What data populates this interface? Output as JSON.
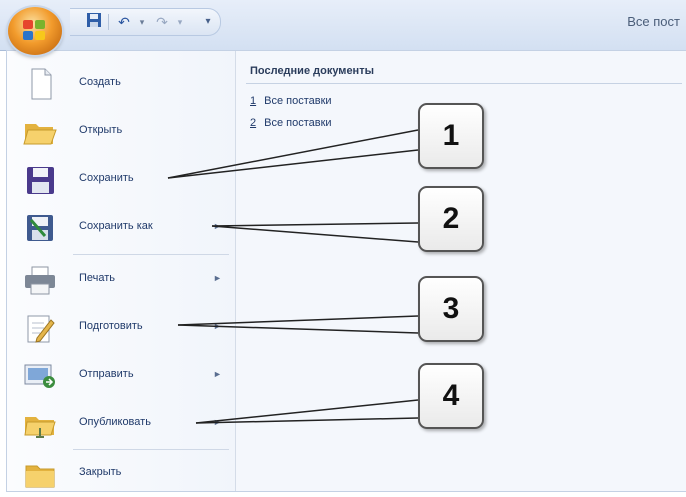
{
  "window": {
    "title_fragment": "Все пост"
  },
  "qat": {
    "buttons": [
      "save-icon",
      "undo-icon",
      "redo-icon",
      "customize-icon"
    ]
  },
  "commands": [
    {
      "label": "Создать",
      "icon": "new-document-icon",
      "submenu": false
    },
    {
      "label": "Открыть",
      "icon": "open-folder-icon",
      "submenu": false
    },
    {
      "label": "Сохранить",
      "icon": "floppy-disk-icon",
      "submenu": false
    },
    {
      "label": "Сохранить как",
      "icon": "save-as-icon",
      "submenu": true
    },
    {
      "label": "Печать",
      "icon": "printer-icon",
      "submenu": true
    },
    {
      "label": "Подготовить",
      "icon": "prepare-icon",
      "submenu": true
    },
    {
      "label": "Отправить",
      "icon": "send-icon",
      "submenu": true
    },
    {
      "label": "Опубликовать",
      "icon": "publish-icon",
      "submenu": true
    },
    {
      "label": "Закрыть",
      "icon": "close-folder-icon",
      "submenu": false
    }
  ],
  "recent": {
    "title": "Последние документы",
    "items": [
      {
        "number": "1",
        "name": "Все поставки"
      },
      {
        "number": "2",
        "name": "Все поставки"
      }
    ]
  },
  "callouts": [
    "1",
    "2",
    "3",
    "4"
  ],
  "colors": {
    "accent": "#f29b2c",
    "menu_text": "#203a6a",
    "title_bar": "#d3e0f2"
  }
}
